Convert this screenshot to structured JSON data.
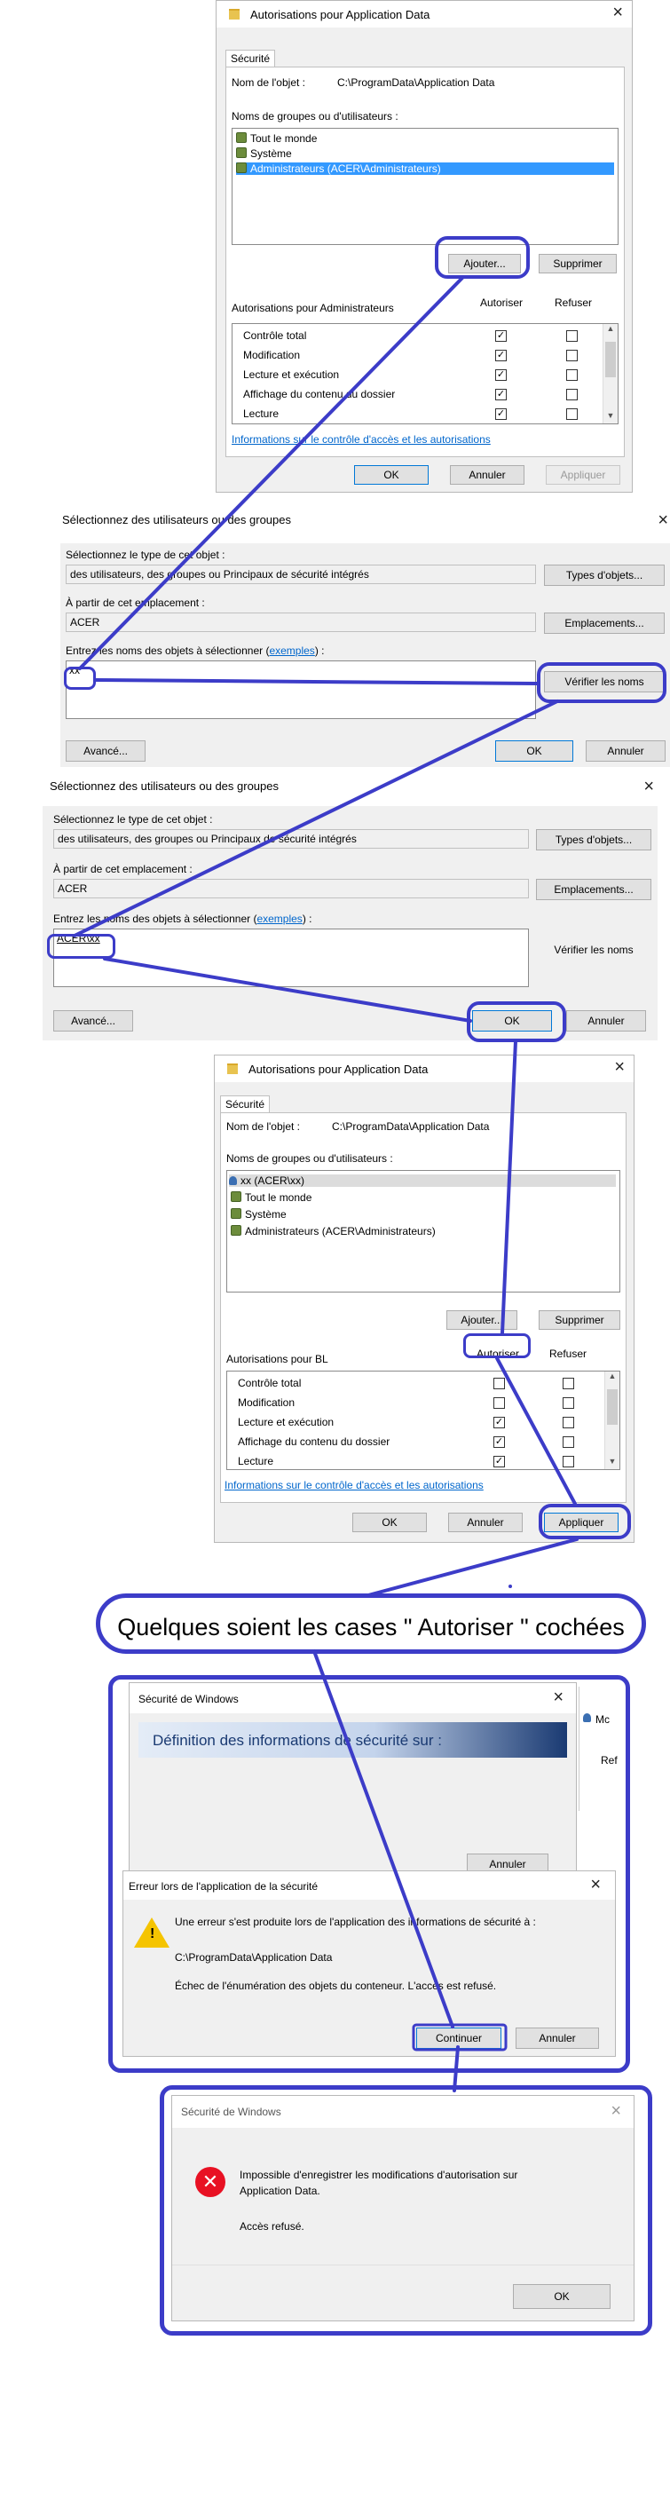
{
  "props": {
    "title": "Autorisations pour Application Data",
    "tab": "Sécurité",
    "object_name_label": "Nom de l'objet :",
    "object_name_value": "C:\\ProgramData\\Application Data",
    "groups_label": "Noms de groupes ou d'utilisateurs :",
    "groups1": [
      "Tout le monde",
      "Système",
      "Administrateurs (ACER\\Administrateurs)"
    ],
    "add_button": "Ajouter...",
    "remove_button": "Supprimer",
    "perm_label_admin": "Autorisations pour Administrateurs",
    "allow_header": "Autoriser",
    "deny_header": "Refuser",
    "permissions": [
      "Contrôle total",
      "Modification",
      "Lecture et exécution",
      "Affichage du contenu du dossier",
      "Lecture"
    ],
    "allowed1": [
      true,
      true,
      true,
      true,
      true
    ],
    "link": "Informations sur le contrôle d'accès et les autorisations",
    "ok": "OK",
    "cancel": "Annuler",
    "apply": "Appliquer",
    "groups2": [
      "xx (ACER\\xx)",
      "Tout le monde",
      "Système",
      "Administrateurs (ACER\\Administrateurs)"
    ],
    "perm_label_bl": "Autorisations pour BL",
    "allowed2": [
      false,
      false,
      true,
      true,
      true
    ]
  },
  "select": {
    "title": "Sélectionnez des utilisateurs ou des groupes",
    "type_label": "Sélectionnez le type de cet objet :",
    "type_value": "des utilisateurs, des groupes ou Principaux de sécurité intégrés",
    "types_button": "Types d'objets...",
    "location_label": "À partir de cet emplacement :",
    "location_value": "ACER",
    "locations_button": "Emplacements...",
    "names_label_pre": "Entrez les noms des objets à sélectionner (",
    "names_label_link": "exemples",
    "names_label_post": ") :",
    "entry1": "xx",
    "entry2": "ACER\\xx",
    "check_button": "Vérifier les noms",
    "advanced_button": "Avancé...",
    "ok": "OK",
    "cancel": "Annuler"
  },
  "banner": "Quelques soient les cases \" Autoriser  \" cochées",
  "winsec": {
    "title": "Sécurité de Windows",
    "heading": "Définition des informations de sécurité sur :",
    "cancel": "Annuler",
    "side_a": "Mc",
    "side_b": "Ref"
  },
  "error": {
    "title": "Erreur lors de l'application de la sécurité",
    "line1": "Une erreur s'est produite lors de l'application des informations de sécurité à :",
    "line2": "C:\\ProgramData\\Application Data",
    "line3": "Échec de l'énumération des objets du conteneur. L'accès est refusé.",
    "continue": "Continuer",
    "cancel": "Annuler"
  },
  "final": {
    "title": "Sécurité de Windows",
    "line1": "Impossible d'enregistrer les modifications d'autorisation sur Application Data.",
    "line2": "Accès refusé.",
    "ok": "OK"
  },
  "colors": {
    "annotation": "#3c3cc8",
    "selection": "#3399ff",
    "link": "#0066cc",
    "error": "#e81123",
    "warning": "#f5c400"
  }
}
